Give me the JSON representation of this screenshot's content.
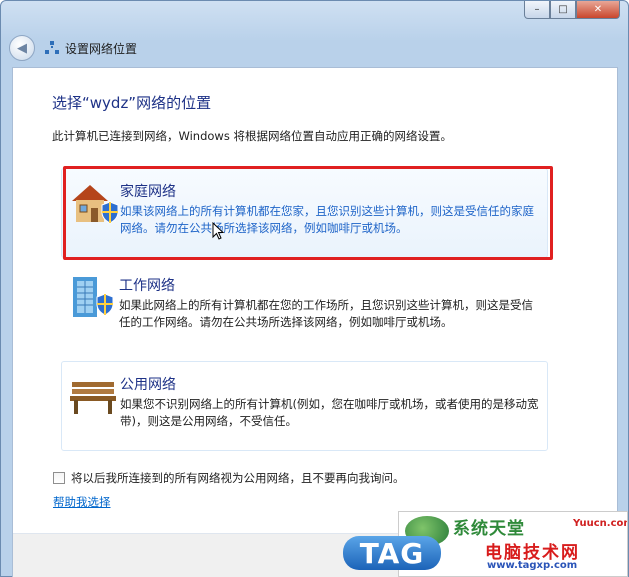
{
  "window": {
    "title": "设置网络位置",
    "controls": {
      "minimize": "–",
      "maximize": "□",
      "close": "✕"
    }
  },
  "main": {
    "heading": "选择“wydz”网络的位置",
    "description": "此计算机已连接到网络，Windows 将根据网络位置自动应用正确的网络设置。",
    "options": [
      {
        "title": "家庭网络",
        "description": "如果该网络上的所有计算机都在您家，且您识别这些计算机，则这是受信任的家庭网络。请勿在公共场所选择该网络，例如咖啡厅或机场。",
        "icon": "home-network-icon"
      },
      {
        "title": "工作网络",
        "description": "如果此网络上的所有计算机都在您的工作场所，且您识别这些计算机，则这是受信任的工作网络。请勿在公共场所选择该网络，例如咖啡厅或机场。",
        "icon": "work-network-icon"
      },
      {
        "title": "公用网络",
        "description": "如果您不识别网络上的所有计算机(例如，您在咖啡厅或机场，或者使用的是移动宽带)，则这是公用网络，不受信任。",
        "icon": "public-network-icon"
      }
    ],
    "checkbox_label": "将以后我所连接到的所有网络视为公用网络，且不要再向我询问。",
    "checkbox_checked": false,
    "help_link": "帮助我选择"
  },
  "watermark": {
    "tag_text": "TAG",
    "site_top": "系统天堂",
    "site_top_latin": "Yuucn.com",
    "site_name": "电脑技术网",
    "site_url": "www.tagxp.com"
  },
  "colors": {
    "heading": "#1e3287",
    "highlight": "#e02020",
    "link": "#0066cc"
  }
}
